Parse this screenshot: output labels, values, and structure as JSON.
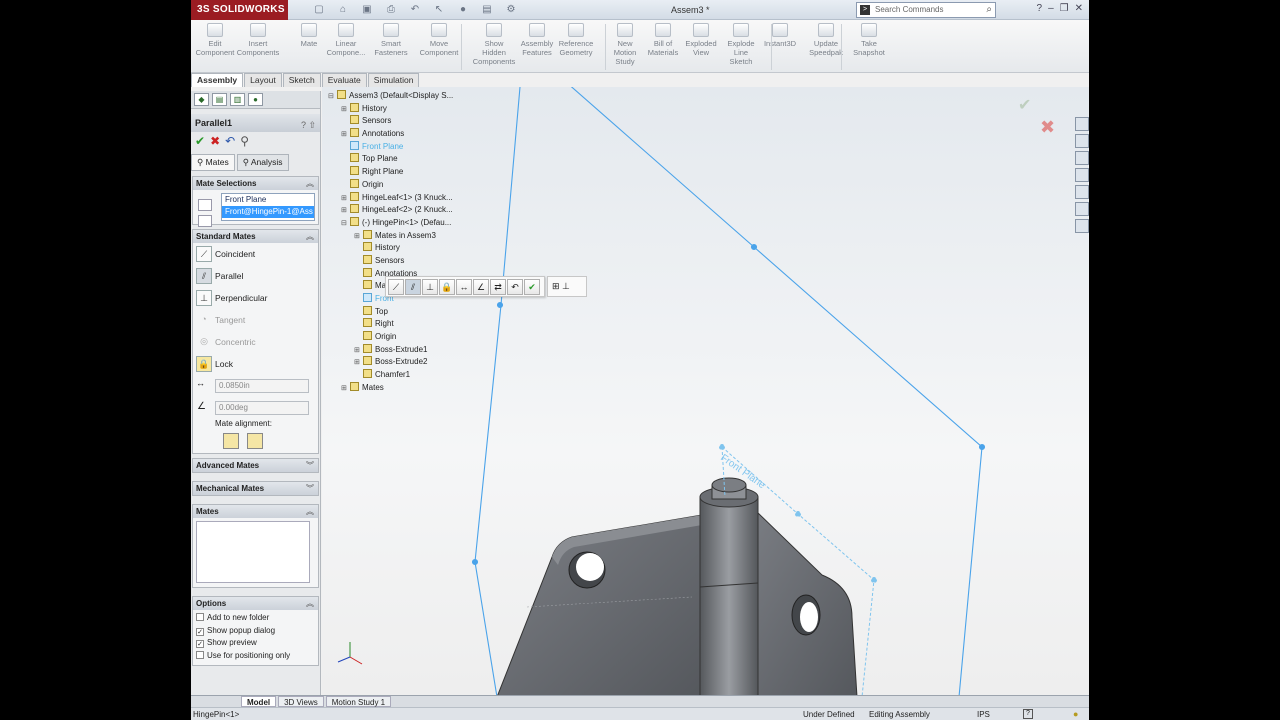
{
  "app": {
    "brand": "3S SOLIDWORKS",
    "document_title": "Assem3 *"
  },
  "search": {
    "placeholder": "Search Commands"
  },
  "ribbon": [
    {
      "label": "Edit\nComponent"
    },
    {
      "label": "Insert\nComponents"
    },
    {
      "label": "Mate"
    },
    {
      "label": "Linear\nCompone..."
    },
    {
      "label": "Smart\nFasteners"
    },
    {
      "label": "Move\nComponent"
    },
    {
      "label": "Show\nHidden\nComponents"
    },
    {
      "label": "Assembly\nFeatures"
    },
    {
      "label": "Reference\nGeometry"
    },
    {
      "label": "New\nMotion\nStudy"
    },
    {
      "label": "Bill of\nMaterials"
    },
    {
      "label": "Exploded\nView"
    },
    {
      "label": "Explode\nLine\nSketch"
    },
    {
      "label": "Instant3D"
    },
    {
      "label": "Update\nSpeedpak"
    },
    {
      "label": "Take\nSnapshot"
    }
  ],
  "tabs": [
    "Assembly",
    "Layout",
    "Sketch",
    "Evaluate",
    "Simulation"
  ],
  "pm": {
    "title": "Parallel1",
    "tab_mates": "Mates",
    "tab_analysis": "Analysis",
    "mate_selections": "Mate Selections",
    "selections": [
      "Front Plane",
      "Front@HingePin-1@Ass"
    ],
    "standard_mates": "Standard Mates",
    "mates": [
      "Coincident",
      "Parallel",
      "Perpendicular",
      "Tangent",
      "Concentric",
      "Lock"
    ],
    "distance": "0.0850in",
    "angle": "0.00deg",
    "mate_alignment": "Mate alignment:",
    "advanced": "Advanced Mates",
    "mechanical": "Mechanical Mates",
    "mates_box": "Mates",
    "options": "Options",
    "option_items": [
      {
        "label": "Add to new folder",
        "checked": false
      },
      {
        "label": "Show popup dialog",
        "checked": true
      },
      {
        "label": "Show preview",
        "checked": true
      },
      {
        "label": "Use for positioning only",
        "checked": false
      }
    ]
  },
  "tree": [
    {
      "label": "Assem3  (Default<Display S...",
      "indent": 0,
      "exp": "-"
    },
    {
      "label": "History",
      "indent": 1,
      "exp": "+"
    },
    {
      "label": "Sensors",
      "indent": 1,
      "exp": ""
    },
    {
      "label": "Annotations",
      "indent": 1,
      "exp": "+"
    },
    {
      "label": "Front Plane",
      "indent": 1,
      "exp": "",
      "blue": true
    },
    {
      "label": "Top Plane",
      "indent": 1,
      "exp": ""
    },
    {
      "label": "Right Plane",
      "indent": 1,
      "exp": ""
    },
    {
      "label": "Origin",
      "indent": 1,
      "exp": ""
    },
    {
      "label": "HingeLeaf<1> (3 Knuck...",
      "indent": 1,
      "exp": "+"
    },
    {
      "label": "HingeLeaf<2> (2 Knuck...",
      "indent": 1,
      "exp": "+"
    },
    {
      "label": "(-) HingePin<1> (Defau...",
      "indent": 1,
      "exp": "-"
    },
    {
      "label": "Mates in Assem3",
      "indent": 2,
      "exp": "+"
    },
    {
      "label": "History",
      "indent": 2,
      "exp": ""
    },
    {
      "label": "Sensors",
      "indent": 2,
      "exp": ""
    },
    {
      "label": "Annotations",
      "indent": 2,
      "exp": ""
    },
    {
      "label": "Material <not specif...",
      "indent": 2,
      "exp": ""
    },
    {
      "label": "Front",
      "indent": 2,
      "exp": "",
      "blue": true
    },
    {
      "label": "Top",
      "indent": 2,
      "exp": ""
    },
    {
      "label": "Right",
      "indent": 2,
      "exp": ""
    },
    {
      "label": "Origin",
      "indent": 2,
      "exp": ""
    },
    {
      "label": "Boss-Extrude1",
      "indent": 2,
      "exp": "+"
    },
    {
      "label": "Boss-Extrude2",
      "indent": 2,
      "exp": "+"
    },
    {
      "label": "Chamfer1",
      "indent": 2,
      "exp": ""
    },
    {
      "label": "Mates",
      "indent": 1,
      "exp": "+"
    }
  ],
  "viewport": {
    "plane_label": "Front Plane"
  },
  "bottom_tabs": [
    "Model",
    "3D Views",
    "Motion Study 1"
  ],
  "status": {
    "left": "HingePin<1>",
    "state": "Under Defined",
    "mode": "Editing Assembly",
    "units": "IPS"
  }
}
